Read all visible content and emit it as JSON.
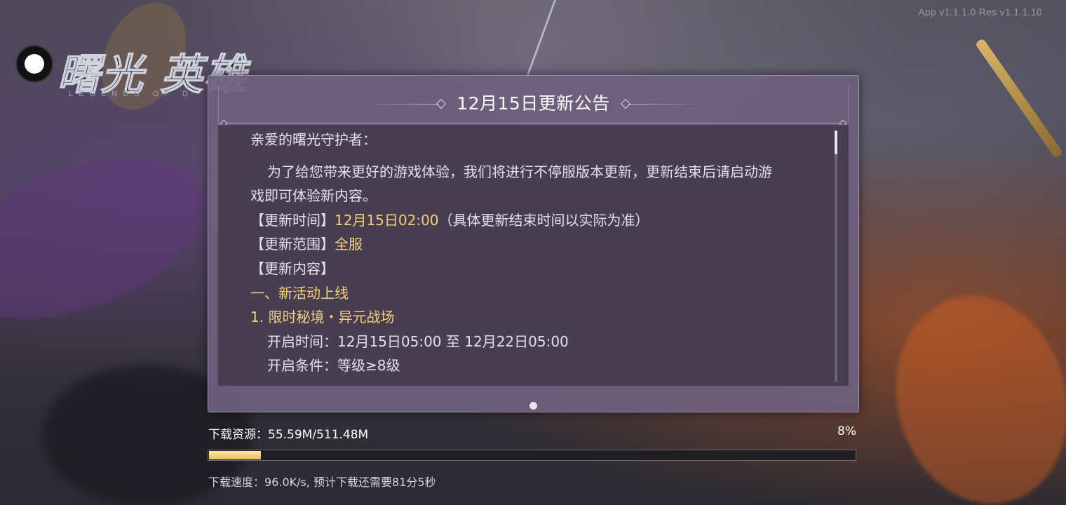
{
  "version": "App v1.1.1.0  Res v1.1.1.10",
  "logo": {
    "title": "曙光 英雄",
    "subtitle": "LEGENDS OF D"
  },
  "announcement": {
    "title": "12月15日更新公告",
    "greeting": "亲爱的曙光守护者：",
    "intro_line1": "为了给您带来更好的游戏体验，我们将进行不停服版本更新，更新结束后请启动游",
    "intro_line2": "戏即可体验新内容。",
    "time_label": "【更新时间】",
    "time_value": "12月15日02:00",
    "time_note": "（具体更新结束时间以实际为准）",
    "scope_label": "【更新范围】",
    "scope_value": "全服",
    "content_label": "【更新内容】",
    "section1_title": "一、新活动上线",
    "item1_title": "1. 限时秘境・异元战场",
    "item1_open_time": "开启时间：12月15日05:00 至 12月22日05:00",
    "item1_condition": "开启条件：等级≥8级",
    "scroll_position": 0
  },
  "download": {
    "label": "下载资源：55.59M/511.48M",
    "percent_text": "8%",
    "progress": 0.08,
    "speed_text": "下载速度：96.0K/s, 预计下载还需要81分5秒"
  },
  "colors": {
    "highlight": "#f5cf7a",
    "panel": "#6e607d",
    "progress_fill": "#e8bf5d"
  }
}
